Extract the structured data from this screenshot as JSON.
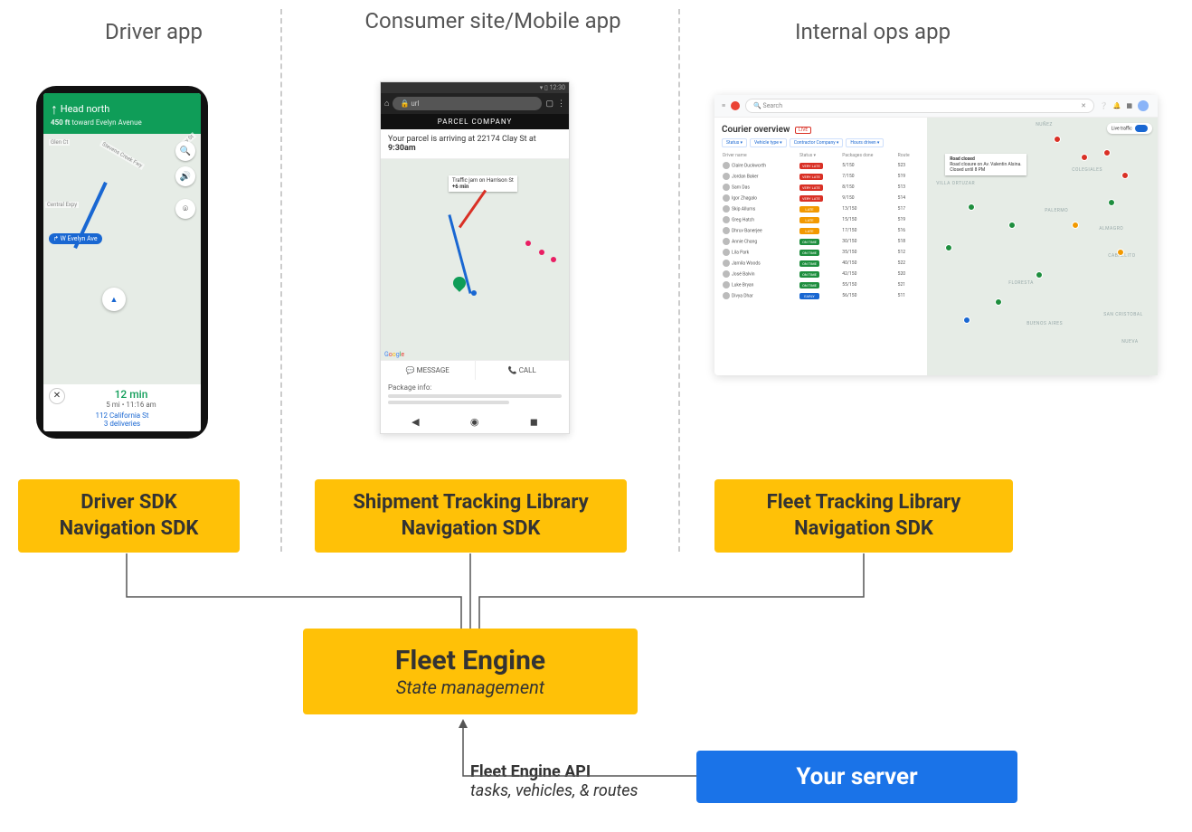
{
  "columns": {
    "driver": {
      "title": "Driver app"
    },
    "consumer": {
      "title": "Consumer site/Mobile app"
    },
    "ops": {
      "title": "Internal ops app"
    }
  },
  "sdk_boxes": {
    "driver": {
      "line1": "Driver SDK",
      "line2": "Navigation SDK"
    },
    "consumer": {
      "line1": "Shipment Tracking Library",
      "line2": "Navigation SDK"
    },
    "ops": {
      "line1": "Fleet Tracking Library",
      "line2": "Navigation SDK"
    }
  },
  "engine": {
    "title": "Fleet Engine",
    "subtitle": "State management"
  },
  "server": {
    "label": "Your server"
  },
  "api": {
    "title": "Fleet Engine API",
    "subtitle": "tasks, vehicles, & routes"
  },
  "driver_app": {
    "direction": "Head north",
    "dist": "450 ft",
    "toward": "toward Evelyn Avenue",
    "chip": "↱ W Evelyn Ave",
    "eta": "12 min",
    "eta_sub": "5 mi • 11:16 am",
    "dest": "112 California St",
    "deliveries": "3 deliveries",
    "street1": "Central Expy",
    "street2": "Glen Ct",
    "street3": "Stevens Creek Fwy",
    "street4": "Easy St",
    "close": "✕"
  },
  "consumer_app": {
    "status_time": "12:30",
    "url": "url",
    "brand": "PARCEL COMPANY",
    "notice_pre": "Your parcel is arriving at 22174 Clay St at ",
    "notice_time": "9:30am",
    "traffic_tip": "Traffic jam on Harrison St",
    "traffic_eta": "+6 min",
    "action_msg": "MESSAGE",
    "action_call": "CALL",
    "pkg_label": "Package info:"
  },
  "ops_app": {
    "search_placeholder": "Search",
    "title": "Courier overview",
    "live": "LIVE",
    "traffic": "Live traffic",
    "filters": [
      "Status",
      "Vehicle type",
      "Contractor Company",
      "Hours driven"
    ],
    "headers": [
      "Driver name",
      "Status",
      "Packages done",
      "Route"
    ],
    "rows": [
      {
        "name": "Claire Duckworth",
        "status": "VERY LATE",
        "badge": "b-red",
        "pkg": "5/150",
        "route": "523"
      },
      {
        "name": "Jordan Baker",
        "status": "VERY LATE",
        "badge": "b-red",
        "pkg": "7/150",
        "route": "519"
      },
      {
        "name": "Sam Das",
        "status": "VERY LATE",
        "badge": "b-red",
        "pkg": "8/150",
        "route": "513"
      },
      {
        "name": "Igor Zhagalo",
        "status": "VERY LATE",
        "badge": "b-red",
        "pkg": "9/150",
        "route": "514"
      },
      {
        "name": "Skip Allums",
        "status": "LATE",
        "badge": "b-orange",
        "pkg": "13/150",
        "route": "517"
      },
      {
        "name": "Greg Hatch",
        "status": "LATE",
        "badge": "b-orange",
        "pkg": "15/150",
        "route": "519"
      },
      {
        "name": "Dhruv Banerjee",
        "status": "LATE",
        "badge": "b-orange",
        "pkg": "17/150",
        "route": "516"
      },
      {
        "name": "Annie Chang",
        "status": "ON TIME",
        "badge": "b-green",
        "pkg": "30/150",
        "route": "518"
      },
      {
        "name": "Lila Park",
        "status": "ON TIME",
        "badge": "b-green",
        "pkg": "35/150",
        "route": "512"
      },
      {
        "name": "Jamila Woods",
        "status": "ON TIME",
        "badge": "b-green",
        "pkg": "40/150",
        "route": "522"
      },
      {
        "name": "José Balvin",
        "status": "ON TIME",
        "badge": "b-green",
        "pkg": "42/150",
        "route": "520"
      },
      {
        "name": "Luke Bryan",
        "status": "ON TIME",
        "badge": "b-green",
        "pkg": "55/150",
        "route": "521"
      },
      {
        "name": "Divya Dhar",
        "status": "EARLY",
        "badge": "b-blue",
        "pkg": "56/150",
        "route": "511"
      }
    ],
    "tip_title": "Road closed",
    "tip_body": "Road closure on Av. Valentin Alsina. Closed until 8 PM",
    "map_labels": [
      "NUÑEZ",
      "COLEGIALES",
      "VILLA ORTUZAR",
      "PALERMO",
      "ALMAGRO",
      "CABALLITO",
      "FLORESTA",
      "BUENOS AIRES",
      "SAN CRISTOBAL",
      "NUEVA"
    ]
  }
}
